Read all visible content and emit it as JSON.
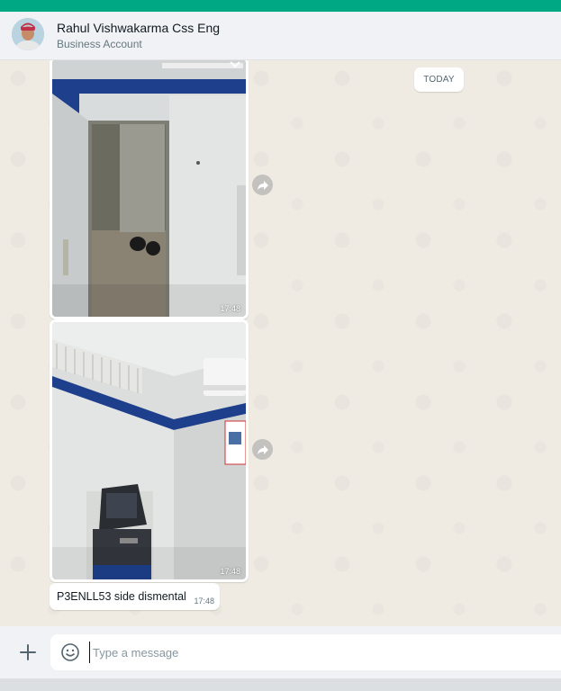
{
  "header": {
    "contact_name": "Rahul Vishwakarma Css Eng",
    "subtitle": "Business Account",
    "avatar": "profile-photo"
  },
  "chat": {
    "date_divider": "TODAY",
    "messages": [
      {
        "type": "image",
        "time": "17:48",
        "description": "photo-doorway-room"
      },
      {
        "type": "image",
        "time": "17:48",
        "description": "photo-atm-corner"
      },
      {
        "type": "text",
        "text": "P3ENLL53 side dismental",
        "time": "17:48"
      }
    ]
  },
  "composer": {
    "placeholder": "Type a message",
    "attach_icon": "plus-icon",
    "emoji_icon": "emoji-icon"
  },
  "colors": {
    "brand": "#00a884",
    "header_bg": "#f0f2f5",
    "chat_bg": "#efeae2",
    "bubble_bg": "#ffffff"
  }
}
